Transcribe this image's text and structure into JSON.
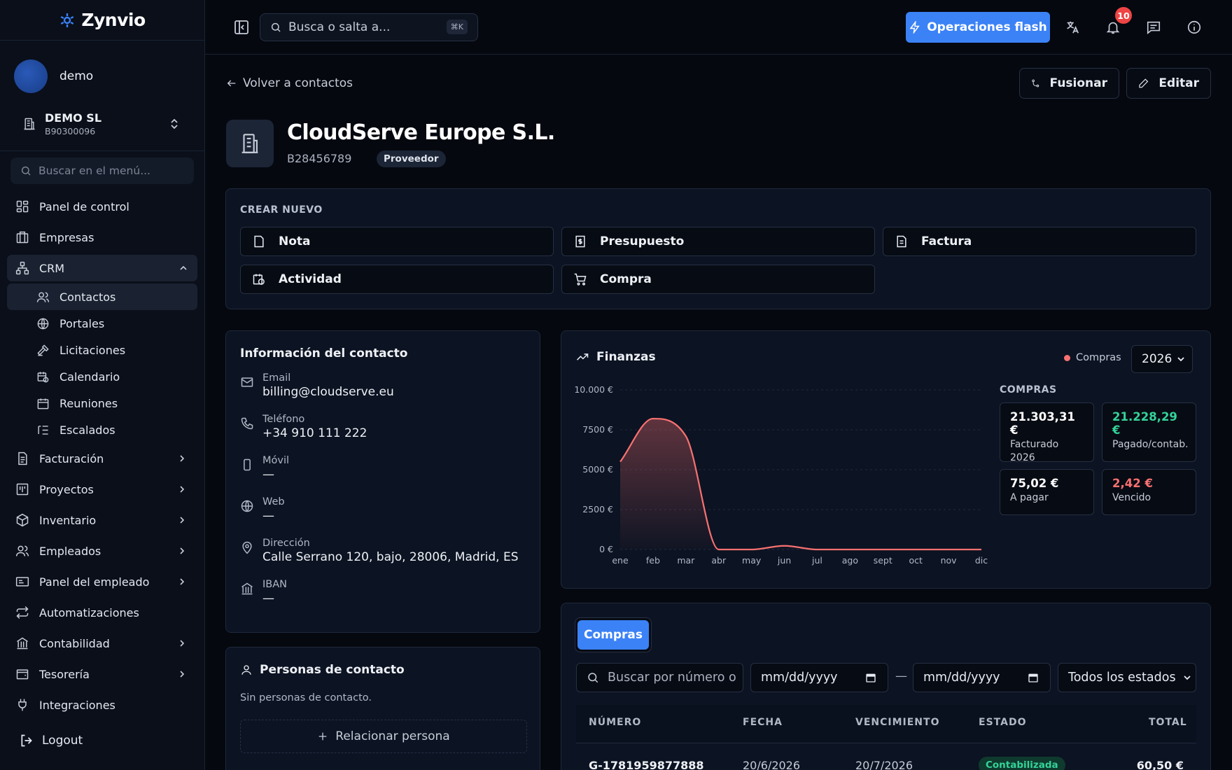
{
  "app": {
    "name": "Zynvio"
  },
  "user": {
    "name": "demo"
  },
  "company": {
    "name": "DEMO SL",
    "nif": "B90300096"
  },
  "sidebar": {
    "search_placeholder": "Buscar en el menú...",
    "items": [
      {
        "label": "Panel de control",
        "icon": "dashboard-icon"
      },
      {
        "label": "Empresas",
        "icon": "building-icon"
      },
      {
        "label": "CRM",
        "icon": "network-icon"
      },
      {
        "label": "Facturación",
        "icon": "invoice-icon"
      },
      {
        "label": "Proyectos",
        "icon": "kanban-icon"
      },
      {
        "label": "Inventario",
        "icon": "box-icon"
      },
      {
        "label": "Empleados",
        "icon": "users-icon"
      },
      {
        "label": "Panel del empleado",
        "icon": "panel-icon"
      },
      {
        "label": "Automatizaciones",
        "icon": "repeat-icon"
      },
      {
        "label": "Contabilidad",
        "icon": "bank-icon"
      },
      {
        "label": "Tesorería",
        "icon": "wallet-icon"
      },
      {
        "label": "Integraciones",
        "icon": "plug-icon"
      }
    ],
    "crm_sub": [
      {
        "label": "Contactos"
      },
      {
        "label": "Portales"
      },
      {
        "label": "Licitaciones"
      },
      {
        "label": "Calendario"
      },
      {
        "label": "Reuniones"
      },
      {
        "label": "Escalados"
      }
    ],
    "logout": "Logout"
  },
  "topbar": {
    "search_placeholder": "Busca o salta a...",
    "shortcut": "⌘K",
    "flash_label": "Operaciones flash",
    "notifications_count": "10"
  },
  "contact": {
    "back_label": "Volver a contactos",
    "merge_label": "Fusionar",
    "edit_label": "Editar",
    "name": "CloudServe Europe S.L.",
    "nif": "B28456789",
    "type_badge": "Proveedor"
  },
  "create_new": {
    "title": "CREAR NUEVO",
    "buttons": [
      "Nota",
      "Presupuesto",
      "Factura",
      "Actividad",
      "Compra"
    ]
  },
  "info": {
    "title": "Información del contacto",
    "fields": [
      {
        "label": "Email",
        "value": "billing@cloudserve.eu"
      },
      {
        "label": "Teléfono",
        "value": "+34 910 111 222"
      },
      {
        "label": "Móvil",
        "value": "—"
      },
      {
        "label": "Web",
        "value": "—"
      },
      {
        "label": "Dirección",
        "value": "Calle Serrano 120, bajo, 28006, Madrid, ES"
      },
      {
        "label": "IBAN",
        "value": "—"
      }
    ]
  },
  "persons": {
    "title": "Personas de contacto",
    "empty": "Sin personas de contacto.",
    "add_label": "Relacionar persona"
  },
  "finance": {
    "title": "Finanzas",
    "legend": "Compras",
    "year": "2026",
    "stats_title": "COMPRAS",
    "stats": [
      {
        "value": "21.303,31 €",
        "label": "Facturado 2026",
        "color": "#ffffff"
      },
      {
        "value": "21.228,29 €",
        "label": "Pagado/contab.",
        "color": "#34d399"
      },
      {
        "value": "75,02 €",
        "label": "A pagar",
        "color": "#ffffff"
      },
      {
        "value": "2,42 €",
        "label": "Vencido",
        "color": "#f87171"
      }
    ]
  },
  "chart_data": {
    "type": "area",
    "categories": [
      "ene",
      "feb",
      "mar",
      "abr",
      "may",
      "jun",
      "jul",
      "ago",
      "sept",
      "oct",
      "nov",
      "dic"
    ],
    "series": [
      {
        "name": "Compras",
        "values": [
          5500,
          8200,
          7100,
          0,
          0,
          230,
          0,
          0,
          0,
          0,
          0,
          0
        ]
      }
    ],
    "yticks": [
      "10.000 €",
      "7500 €",
      "5000 €",
      "2500 €",
      "0 €"
    ],
    "ylim": [
      0,
      10000
    ],
    "color": "#f87171"
  },
  "purchases": {
    "tab": "Compras",
    "search_placeholder": "Buscar por número o",
    "date_from": "mm/dd/yyyy",
    "date_sep": "—",
    "date_to": "mm/dd/yyyy",
    "status_filter": "Todos los estados",
    "columns": [
      "NÚMERO",
      "FECHA",
      "VENCIMIENTO",
      "ESTADO",
      "TOTAL"
    ],
    "rows": [
      {
        "number": "G-1781959877888",
        "date": "20/6/2026",
        "due": "20/7/2026",
        "status": "Contabilizada",
        "total": "60,50 €"
      }
    ]
  }
}
